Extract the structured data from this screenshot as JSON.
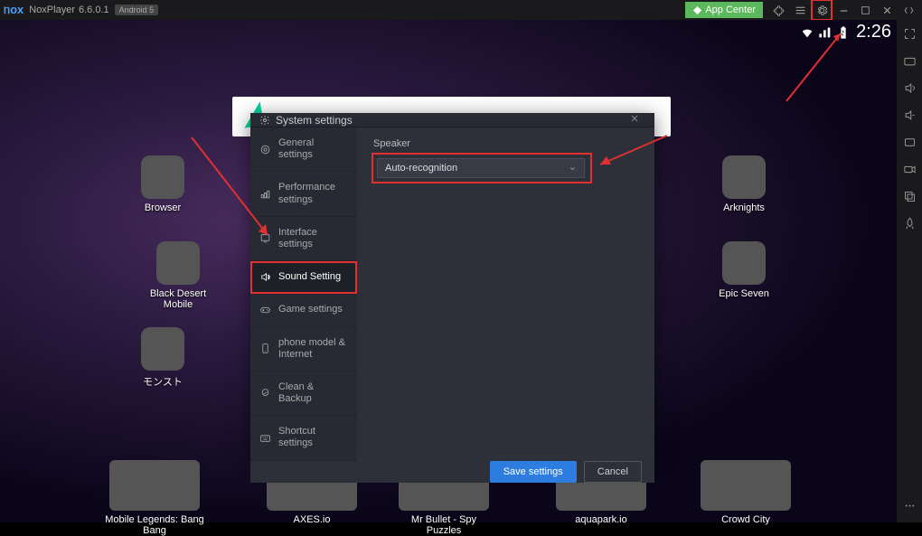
{
  "titlebar": {
    "app_name": "NoxPlayer",
    "version": "6.6.0.1",
    "android_tag": "Android 5",
    "app_center": "App Center"
  },
  "status": {
    "time": "2:26"
  },
  "dialog": {
    "title": "System settings",
    "nav": {
      "general": "General settings",
      "performance": "Performance settings",
      "interface": "Interface settings",
      "sound": "Sound Setting",
      "game": "Game settings",
      "phone": "phone model & Internet",
      "clean": "Clean & Backup",
      "shortcut": "Shortcut settings"
    },
    "content": {
      "speaker_label": "Speaker",
      "speaker_value": "Auto-recognition"
    },
    "buttons": {
      "save": "Save settings",
      "cancel": "Cancel"
    }
  },
  "icons": {
    "browser": "Browser",
    "bdm": "Black Desert Mobile",
    "monst": "モンスト",
    "arknights": "Arknights",
    "epic": "Epic Seven",
    "mlbb": "Mobile Legends: Bang Bang",
    "axes": "AXES.io",
    "bullet": "Mr Bullet - Spy Puzzles",
    "aqua": "aquapark.io",
    "crowd": "Crowd City"
  }
}
